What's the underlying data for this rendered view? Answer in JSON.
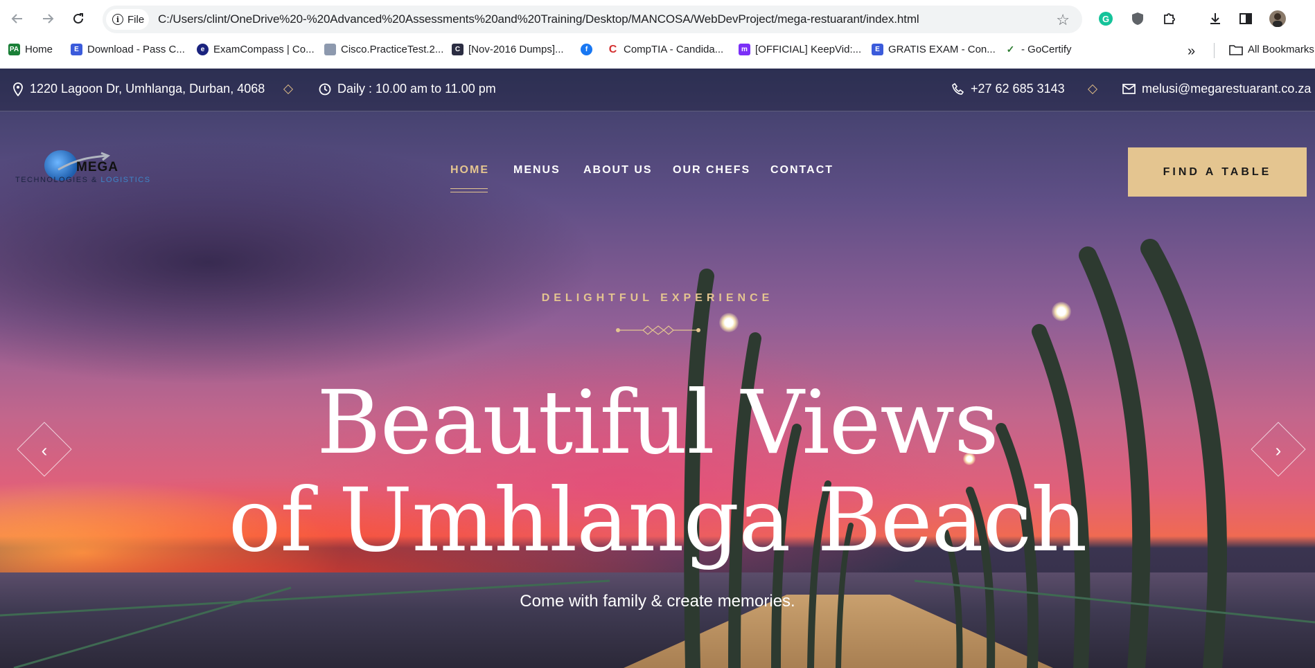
{
  "browser": {
    "file_label": "File",
    "url": "C:/Users/clint/OneDrive%20-%20Advanced%20Assessments%20and%20Training/Desktop/MANCOSA/WebDevProject/mega-restuarant/index.html",
    "bookmarks": [
      {
        "label": "Home",
        "color": "#1a7f37"
      },
      {
        "label": "Download - Pass C...",
        "color": "#3b5bdb"
      },
      {
        "label": "ExamCompass | Co...",
        "color": "#1a237e"
      },
      {
        "label": "Cisco.PracticeTest.2...",
        "color": "#8d99ae"
      },
      {
        "label": "[Nov-2016 Dumps]...",
        "color": "#2b2d42"
      },
      {
        "label": "",
        "color": "#1877f2"
      },
      {
        "label": "CompTIA - Candida...",
        "color": "#d32f2f"
      },
      {
        "label": "[OFFICIAL] KeepVid:...",
        "color": "#7b2ff7"
      },
      {
        "label": "GRATIS EXAM - Con...",
        "color": "#3b5bdb"
      },
      {
        "label": "- GoCertify",
        "color": "#2e7d32"
      }
    ],
    "more_label": "»",
    "all_bookmarks_label": "All Bookmarks"
  },
  "topbar": {
    "address": "1220 Lagoon Dr, Umhlanga, Durban, 4068",
    "hours": "Daily : 10.00 am to 11.00 pm",
    "phone": "+27 62 685 3143",
    "email": "melusi@megarestuarant.co.za"
  },
  "logo": {
    "word": "MEGA",
    "sub_a": "TECHNOLOGIES & ",
    "sub_b": "LOGISTICS"
  },
  "nav": {
    "items": [
      "HOME",
      "MENUS",
      "ABOUT US",
      "OUR CHEFS",
      "CONTACT"
    ],
    "active": "HOME",
    "cta": "FIND A TABLE"
  },
  "hero": {
    "eyebrow": "DELIGHTFUL EXPERIENCE",
    "title_line1": "Beautiful Views",
    "title_line2": "of Umhlanga Beach",
    "subtitle": "Come with family & create memories.",
    "prev_icon": "chevron-left-icon",
    "next_icon": "chevron-right-icon"
  },
  "colors": {
    "accent": "#e4c590",
    "white": "#ffffff"
  }
}
